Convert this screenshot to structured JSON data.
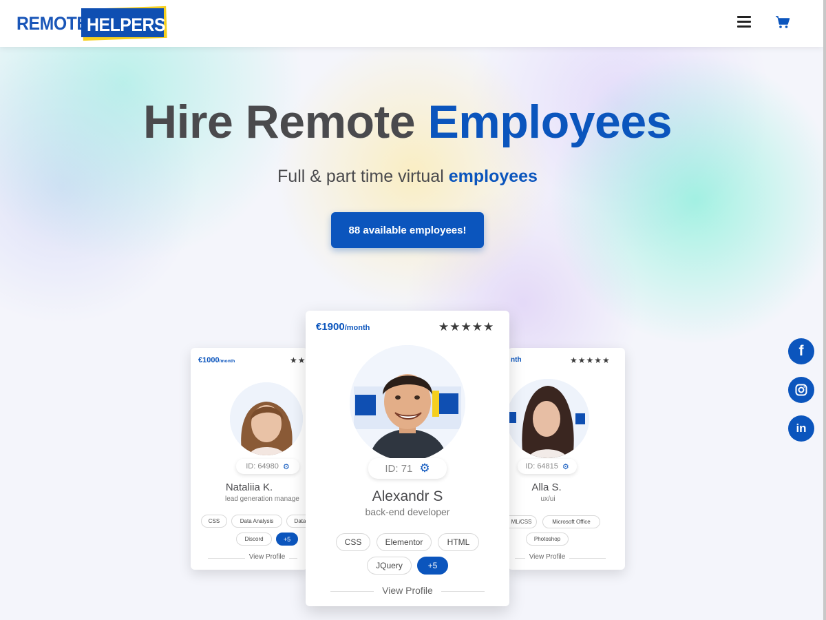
{
  "brand": {
    "logo_left": "REMOTE",
    "logo_right": "HELPERS"
  },
  "colors": {
    "accent": "#0b55bd",
    "logo_yellow": "#f5cf1f",
    "text": "#4a4a4d"
  },
  "header": {
    "menu_icon": "hamburger-menu-icon",
    "cart_icon": "cart-icon"
  },
  "hero": {
    "title_part1": "Hire Remote",
    "title_part2": "Employees",
    "subtitle_part1": "Full & part time virtual",
    "subtitle_part2": "employees",
    "cta_label": "88 available employees!"
  },
  "cards": {
    "left": {
      "price": "€1000",
      "period": "/month",
      "stars": "★★",
      "id": "ID: 64980",
      "name": "Nataliia K.",
      "role": "lead generation manage",
      "tags": [
        "CSS",
        "Data Analysis",
        "Data",
        "Discord"
      ],
      "more": "+5",
      "view": "View Profile"
    },
    "main": {
      "price": "€1900",
      "period": "/month",
      "stars": "★★★★★",
      "id": "ID: 71",
      "name": "Alexandr S",
      "role": "back-end developer",
      "tags": [
        "CSS",
        "Elementor",
        "HTML",
        "JQuery"
      ],
      "more": "+5",
      "view": "View Profile"
    },
    "right": {
      "price": "nth",
      "stars": "★★★★★",
      "id": "ID: 64815",
      "name": "Alla S.",
      "role": "ux/ui",
      "tags": [
        "ML/CSS",
        "Microsoft Office",
        "Photoshop"
      ],
      "view": "View Profile"
    }
  },
  "social": {
    "facebook": "f",
    "instagram_icon": "instagram-icon",
    "linkedin": "in"
  }
}
